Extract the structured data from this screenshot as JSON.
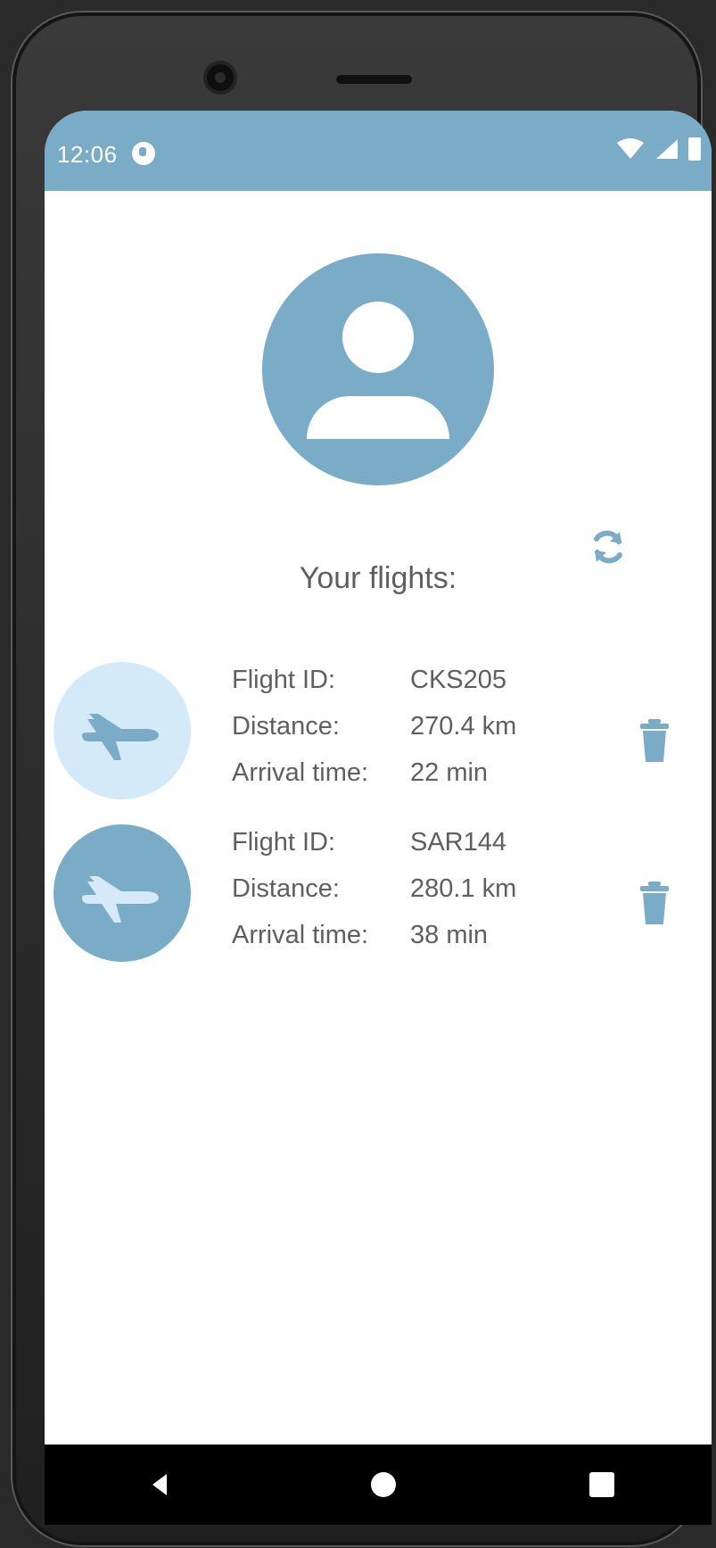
{
  "status_bar": {
    "time": "12:06",
    "accent": "#7aabc7",
    "icons": [
      "record-icon",
      "wifi-icon",
      "signal-icon",
      "battery-icon"
    ]
  },
  "profile": {
    "avatar_icon": "person-icon"
  },
  "actions": {
    "refresh_icon": "refresh-icon"
  },
  "heading": "Your flights:",
  "flights": [
    {
      "badge_color": "#d4eaf8",
      "plane_color": "#7aabc7",
      "labels": {
        "flight_id": "Flight ID:",
        "distance": "Distance:",
        "arrival_time": "Arrival time:"
      },
      "values": {
        "flight_id": "CKS205",
        "distance": "270.4 km",
        "arrival_time": "22 min"
      },
      "delete_icon": "trash-icon"
    },
    {
      "badge_color": "#7aabc7",
      "plane_color": "#d4eaf8",
      "labels": {
        "flight_id": "Flight ID:",
        "distance": "Distance:",
        "arrival_time": "Arrival time:"
      },
      "values": {
        "flight_id": "SAR144",
        "distance": "280.1 km",
        "arrival_time": "38 min"
      },
      "delete_icon": "trash-icon"
    }
  ],
  "navigation": {
    "back_icon": "back-icon",
    "home_icon": "home-icon",
    "recents_icon": "recents-icon"
  }
}
